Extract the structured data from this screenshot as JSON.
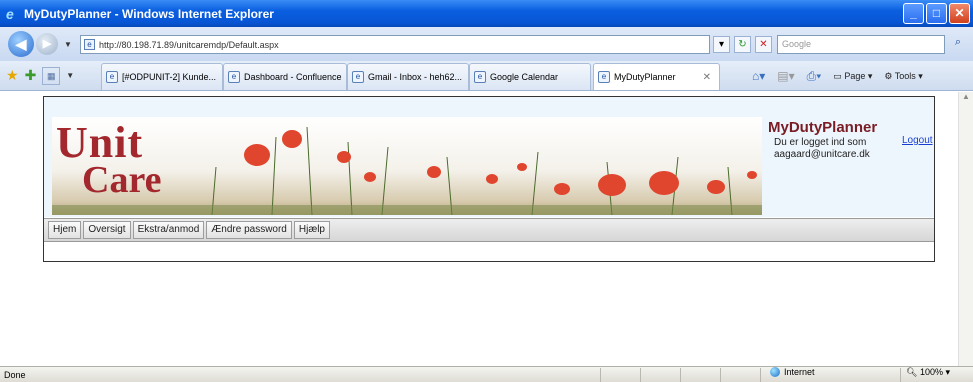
{
  "window": {
    "title": "MyDutyPlanner - Windows Internet Explorer"
  },
  "address": {
    "url": "http://80.198.71.89/unitcaremdp/Default.aspx",
    "search_placeholder": "Google"
  },
  "tabs": [
    {
      "label": "[#ODPUNIT-2] Kunde..."
    },
    {
      "label": "Dashboard - Confluence"
    },
    {
      "label": "Gmail - Inbox - heh62..."
    },
    {
      "label": "Google Calendar"
    },
    {
      "label": "MyDutyPlanner",
      "active": true
    }
  ],
  "command_bar": {
    "page_label": "Page",
    "tools_label": "Tools"
  },
  "site": {
    "logo_line1": "Unit",
    "logo_line2": "Care",
    "app_title": "MyDutyPlanner",
    "logged_in_text": "Du er logget ind som",
    "username": "aagaard@unitcare.dk",
    "logout_label": "Logout",
    "menu": [
      "Hjem",
      "Oversigt",
      "Ekstra/anmod",
      "Ændre password",
      "Hjælp"
    ]
  },
  "status": {
    "text": "Done",
    "zone": "Internet",
    "zoom": "100%"
  },
  "colors": {
    "brand": "#a3282e",
    "titlebar": "#0a5fe0",
    "link": "#1a3fd0"
  }
}
